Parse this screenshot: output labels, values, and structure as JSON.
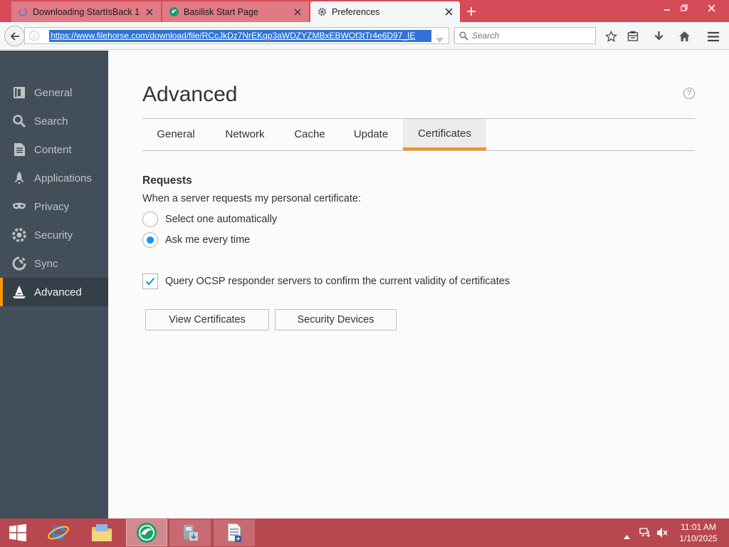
{
  "browser": {
    "tabs": [
      {
        "title": "Downloading StartIsBack 1",
        "favicon": "download-spinner-icon",
        "active": false
      },
      {
        "title": "Basilisk Start Page",
        "favicon": "basilisk-logo-icon",
        "active": false
      },
      {
        "title": "Preferences",
        "favicon": "gear-icon",
        "active": true
      }
    ],
    "url": "https://www.filehorse.com/download/file/RCcJkDz7NrEKqp3aWDZYZMBxEBWOf3tTr4e6D97_IE",
    "search_placeholder": "Search"
  },
  "sidebar": {
    "items": [
      {
        "label": "General",
        "icon": "general-icon",
        "selected": false
      },
      {
        "label": "Search",
        "icon": "search-icon",
        "selected": false
      },
      {
        "label": "Content",
        "icon": "content-icon",
        "selected": false
      },
      {
        "label": "Applications",
        "icon": "applications-icon",
        "selected": false
      },
      {
        "label": "Privacy",
        "icon": "privacy-mask-icon",
        "selected": false
      },
      {
        "label": "Security",
        "icon": "security-padlock-icon",
        "selected": false
      },
      {
        "label": "Sync",
        "icon": "sync-icon",
        "selected": false
      },
      {
        "label": "Advanced",
        "icon": "advanced-wizard-hat-icon",
        "selected": true
      }
    ]
  },
  "main": {
    "heading": "Advanced",
    "help_symbol": "?",
    "tabs": [
      {
        "label": "General",
        "selected": false
      },
      {
        "label": "Network",
        "selected": false
      },
      {
        "label": "Cache",
        "selected": false
      },
      {
        "label": "Update",
        "selected": false
      },
      {
        "label": "Certificates",
        "selected": true
      }
    ],
    "requests": {
      "title": "Requests",
      "description": "When a server requests my personal certificate:",
      "options": [
        {
          "label": "Select one automatically",
          "checked": false
        },
        {
          "label": "Ask me every time",
          "checked": true
        }
      ]
    },
    "ocsp": {
      "label": "Query OCSP responder servers to confirm the current validity of certificates",
      "checked": true
    },
    "buttons": {
      "view_certificates": "View Certificates",
      "security_devices": "Security Devices"
    }
  },
  "taskbar": {
    "time": "11:01 AM",
    "date": "1/10/2025"
  },
  "colors": {
    "tabstrip": "#d64b58",
    "taskbar": "#b9474f",
    "sidebar": "#424f5a",
    "accent": "#ff9500",
    "radio_checked": "#0996f8",
    "url_selection": "#3173d5"
  }
}
